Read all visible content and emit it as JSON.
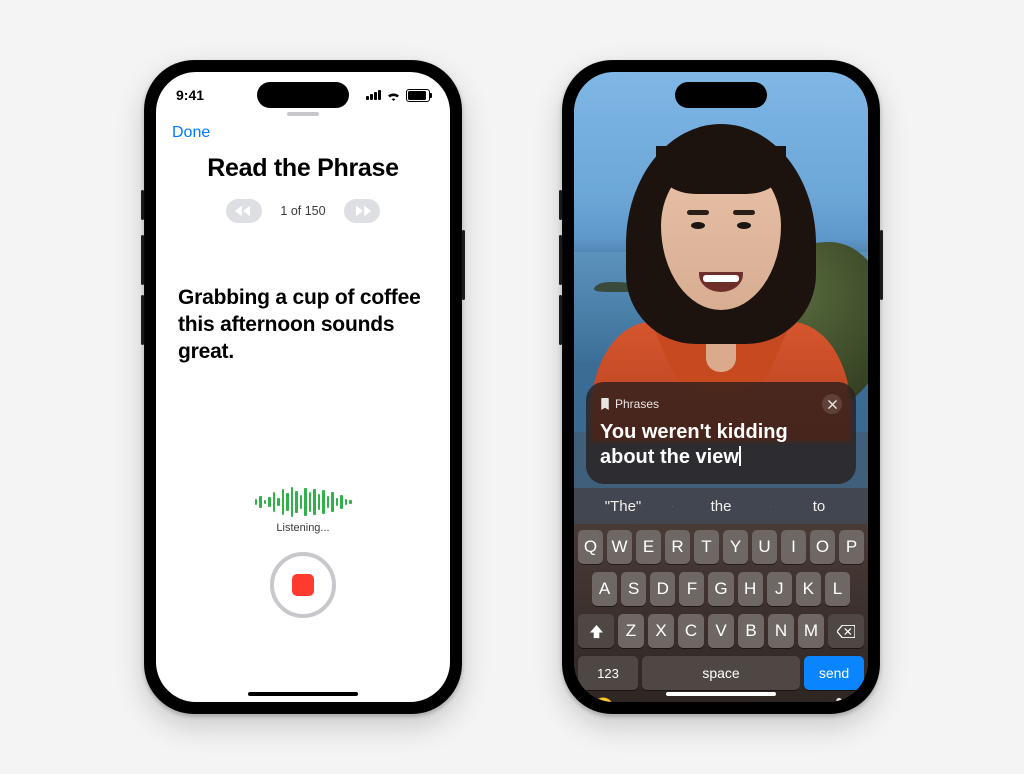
{
  "phone1": {
    "status": {
      "time": "9:41"
    },
    "nav": {
      "done": "Done"
    },
    "title": "Read the Phrase",
    "pager": {
      "text": "1 of 150"
    },
    "phrase": "Grabbing a cup of coffee this afternoon sounds great.",
    "listening": "Listening..."
  },
  "phone2": {
    "bubble": {
      "phrases_label": "Phrases",
      "text_line1": "You weren't kidding",
      "text_line2": "about the view"
    },
    "suggestions": {
      "a": "\"The\"",
      "b": "the",
      "c": "to"
    },
    "keys": {
      "row1": [
        "Q",
        "W",
        "E",
        "R",
        "T",
        "Y",
        "U",
        "I",
        "O",
        "P"
      ],
      "row2": [
        "A",
        "S",
        "D",
        "F",
        "G",
        "H",
        "J",
        "K",
        "L"
      ],
      "row3": [
        "Z",
        "X",
        "C",
        "V",
        "B",
        "N",
        "M"
      ],
      "numbers": "123",
      "space": "space",
      "send": "send"
    }
  }
}
